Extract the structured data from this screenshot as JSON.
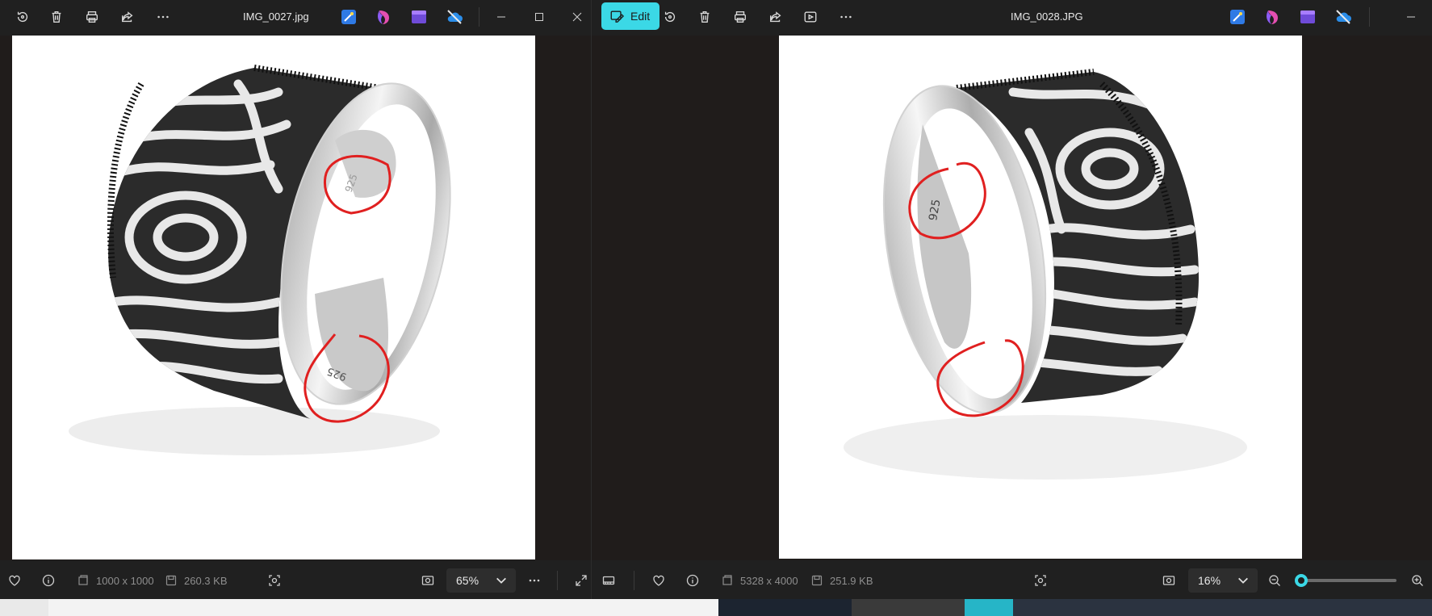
{
  "left_window": {
    "filename": "IMG_0027.jpg",
    "toolbar_icons": [
      "rotate-icon",
      "delete-icon",
      "print-icon",
      "share-icon",
      "more-icon"
    ],
    "dimensions": "1000 x 1000",
    "file_size": "260.3 KB",
    "zoom": "65%",
    "image_label_top": "925",
    "image_label_bottom": "925"
  },
  "right_window": {
    "filename": "IMG_0028.JPG",
    "edit_label": "Edit",
    "toolbar_icons": [
      "rotate-icon",
      "delete-icon",
      "print-icon",
      "share-icon",
      "slideshow-icon",
      "more-icon"
    ],
    "dimensions": "5328 x 4000",
    "file_size": "251.9 KB",
    "zoom": "16%",
    "zoom_slider_level": 0.0,
    "image_label": "925"
  },
  "colors": {
    "accent": "#3bd8e6",
    "annotation": "#e02020",
    "canvas_bg": "#201c1b",
    "chrome_bg": "#202020"
  }
}
